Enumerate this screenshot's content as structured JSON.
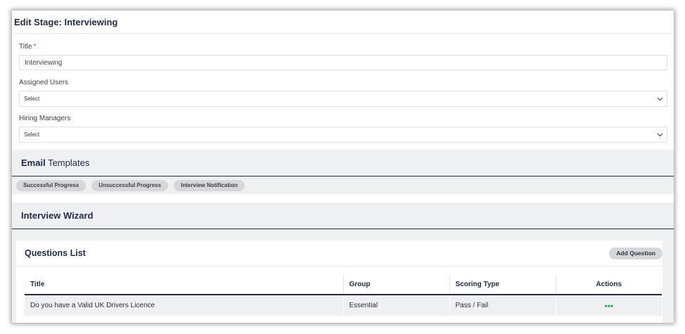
{
  "header": {
    "title": "Edit Stage: Interviewing"
  },
  "form": {
    "title_label": "Title",
    "required_mark": "*",
    "title_value": "Interviewing",
    "assigned_users_label": "Assigned Users",
    "assigned_users_value": "Select",
    "hiring_managers_label": "Hiring Managers",
    "hiring_managers_value": "Select"
  },
  "email_templates": {
    "title_bold": "Email",
    "title_rest": " Templates",
    "chips": [
      "Successful Progress",
      "Unsuccessful Progress",
      "Interview Notification"
    ]
  },
  "interview_wizard": {
    "title": "Interview Wizard"
  },
  "questions": {
    "title": "Questions List",
    "add_button": "Add Question",
    "columns": [
      "Title",
      "Group",
      "Scoring Type",
      "Actions"
    ],
    "rows": [
      {
        "title": "Do you have a Valid UK Drivers Licence",
        "group": "Essential",
        "scoring_type": "Pass / Fail",
        "actions": "•••"
      }
    ]
  },
  "colors": {
    "accent_navy": "#1f2d4a",
    "panel_gray": "#eef0f1",
    "chip_gray": "#d6d7d9",
    "action_green": "#2bb24c",
    "required_red": "#d9342b"
  }
}
